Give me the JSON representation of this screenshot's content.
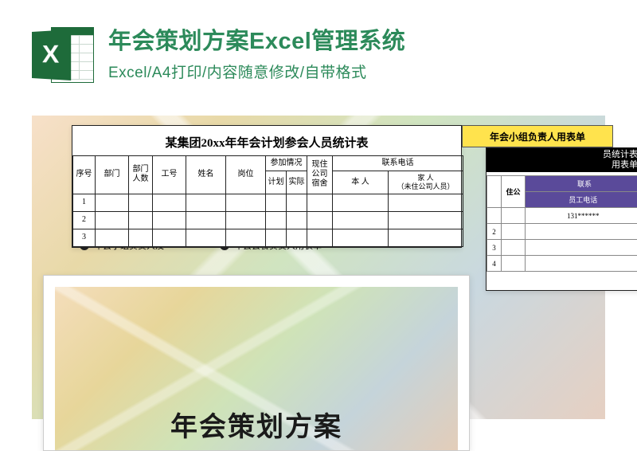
{
  "header": {
    "icon_letter": "X",
    "title": "年会策划方案Excel管理系统",
    "subtitle": "Excel/A4打印/内容随意修改/自带格式"
  },
  "main_table": {
    "title": "某集团20xx年年会计划参会人员统计表",
    "cols": {
      "seq": "序号",
      "dept": "部门",
      "dept_count": "部门人数",
      "emp_no": "工号",
      "name": "姓名",
      "post": "岗位",
      "attend": "参加情况",
      "attend_plan": "计划",
      "attend_actual": "实际",
      "stay": "现住公司宿舍",
      "phone": "联系电话",
      "phone_self": "本  人",
      "phone_family": "家  人\n（未住公司人员）"
    },
    "rows": [
      "1",
      "2",
      "3"
    ]
  },
  "yellow_tab": {
    "label": "年会小组负责人用表单"
  },
  "right_card": {
    "line1": "员统计表",
    "line2": "用表单",
    "h_stay": "住公",
    "h_phone": "联系",
    "h_emp_phone": "员工电话",
    "sample_phone": "131******",
    "rows": [
      "2",
      "3",
      "4"
    ]
  },
  "dots": {
    "item1": "年会小组负责人及",
    "item2": "年会会餐负责人用表单"
  },
  "scheme": {
    "title": "年会策划方案"
  }
}
